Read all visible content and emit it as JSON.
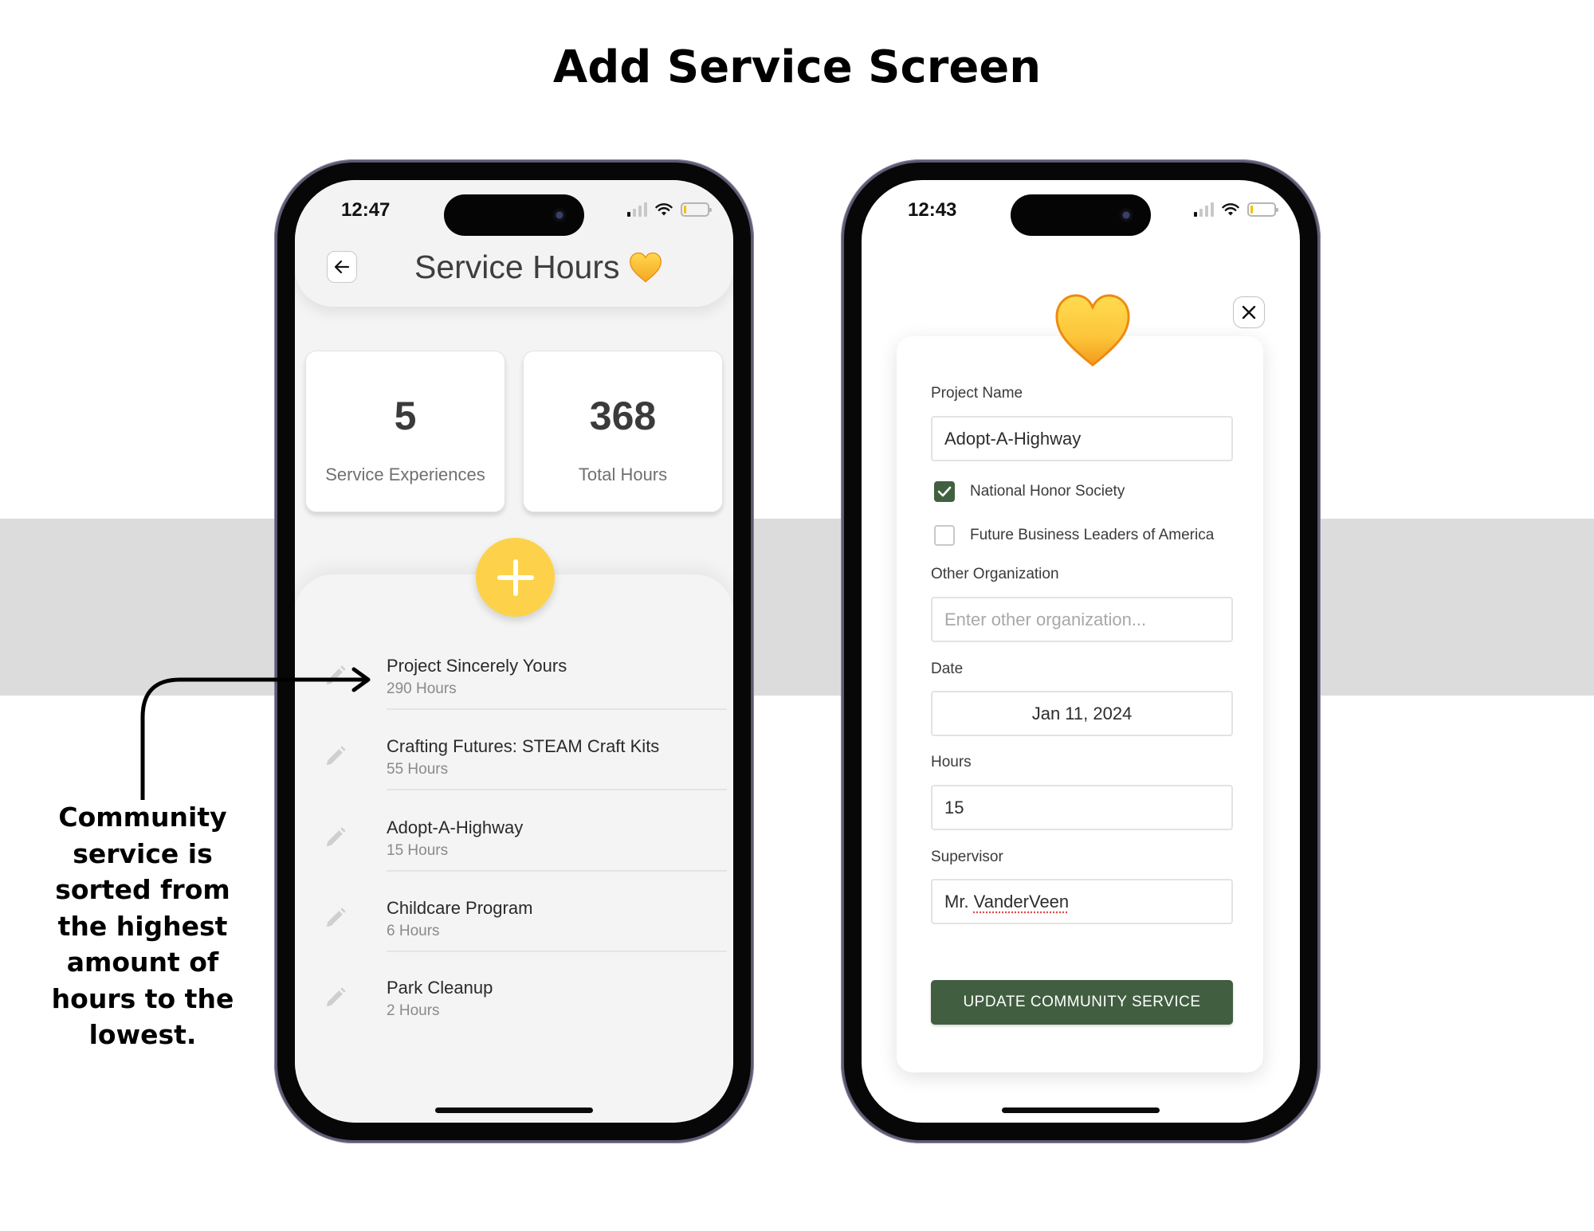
{
  "page": {
    "title": "Add Service Screen",
    "annotation": "Community service is sorted from the highest amount of hours to the lowest."
  },
  "colors": {
    "accent_yellow": "#fdd24a",
    "accent_green": "#425e41",
    "band_gray": "#dcdcdc",
    "list_bg": "#f4f4f4"
  },
  "left_phone": {
    "status": {
      "time": "12:47",
      "icons": [
        "signal-icon",
        "wifi-icon",
        "battery-icon"
      ]
    },
    "header": {
      "back_icon": "arrow-left-icon",
      "title": "Service Hours",
      "title_emoji": "yellow-heart-icon"
    },
    "stats": [
      {
        "value": "5",
        "label": "Service Experiences"
      },
      {
        "value": "368",
        "label": "Total Hours"
      }
    ],
    "fab_icon": "plus-icon",
    "services": [
      {
        "name": "Project Sincerely Yours",
        "hours": "290 Hours"
      },
      {
        "name": "Crafting Futures: STEAM Craft Kits",
        "hours": "55 Hours"
      },
      {
        "name": "Adopt-A-Highway",
        "hours": "15 Hours"
      },
      {
        "name": "Childcare Program",
        "hours": "6 Hours"
      },
      {
        "name": "Park Cleanup",
        "hours": "2 Hours"
      }
    ]
  },
  "right_phone": {
    "status": {
      "time": "12:43",
      "icons": [
        "signal-icon",
        "wifi-icon",
        "battery-icon"
      ]
    },
    "close_icon": "close-icon",
    "form": {
      "project_name": {
        "label": "Project Name",
        "value": "Adopt-A-Highway"
      },
      "organizations": [
        {
          "label": "National Honor Society",
          "checked": true
        },
        {
          "label": "Future Business Leaders of America",
          "checked": false
        }
      ],
      "other_organization": {
        "label": "Other Organization",
        "value": "",
        "placeholder": "Enter other organization..."
      },
      "date": {
        "label": "Date",
        "value": "Jan 11, 2024"
      },
      "hours": {
        "label": "Hours",
        "value": "15"
      },
      "supervisor": {
        "label": "Supervisor",
        "value_prefix": "Mr. ",
        "value_flagged": "VanderVeen"
      },
      "submit_label": "UPDATE COMMUNITY SERVICE"
    }
  }
}
